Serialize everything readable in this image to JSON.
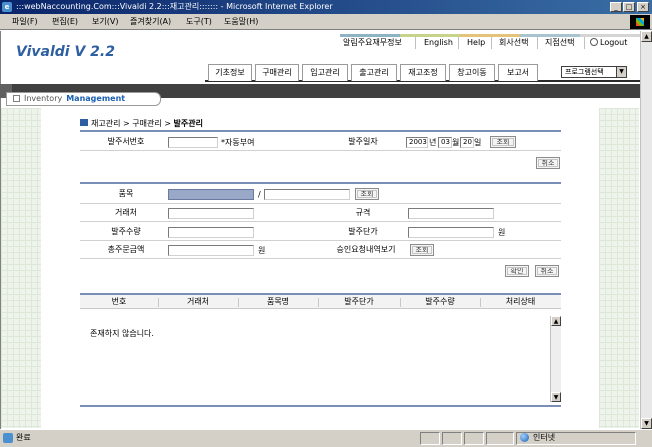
{
  "window": {
    "title": ":::webNaccounting.Com:::Vivaldi 2.2:::재고관리::::::: - Microsoft Internet Explorer",
    "buttons": [
      "_",
      "□",
      "×"
    ]
  },
  "menubar": {
    "items": [
      "파일(F)",
      "편집(E)",
      "보기(V)",
      "즐겨찾기(A)",
      "도구(T)",
      "도움말(H)"
    ]
  },
  "header": {
    "logo": "Vivaldi  V 2.2",
    "top_links": [
      "알림주요재무정보",
      "English",
      "Help",
      "회사선택",
      "지점선택",
      "Logout"
    ],
    "nav_tabs": [
      "기초정보",
      "구매관리",
      "입고관리",
      "출고관리",
      "재고조정",
      "창고이동",
      "보고서"
    ],
    "program_select": "프로그램선택",
    "section_label": "Inventory",
    "section_sub": "Management"
  },
  "breadcrumb": {
    "parts": [
      "재고관리",
      "구매관리"
    ],
    "separator": ">",
    "current": "발주관리"
  },
  "search_form": {
    "order_no_label": "발주서번호",
    "order_no_value": "",
    "auto_text": "*자동부여",
    "order_date_label": "발주일자",
    "year": "2003",
    "year_suffix": "년",
    "month": "03",
    "month_suffix": "월",
    "day": "20",
    "day_suffix": "일",
    "search_btn": "조회",
    "cancel_btn": "취소"
  },
  "detail_form": {
    "item_label": "품목",
    "item_slash": "/",
    "item_search_btn": "조회",
    "vendor_label": "거래처",
    "spec_label": "규격",
    "qty_label": "발주수량",
    "unit_price_label": "발주단가",
    "unit_price_unit": "원",
    "total_label": "총주문금액",
    "total_unit": "원",
    "approval_label": "승인요청내역보기",
    "approval_btn": "조회",
    "confirm_btn": "확인",
    "cancel_btn": "취소"
  },
  "table": {
    "columns": [
      "번호",
      "거래처",
      "품목명",
      "발주단가",
      "발주수량",
      "처리상태"
    ],
    "empty_message": "존재하지 않습니다."
  },
  "statusbar": {
    "text": "완료",
    "zone": "인터넷"
  }
}
